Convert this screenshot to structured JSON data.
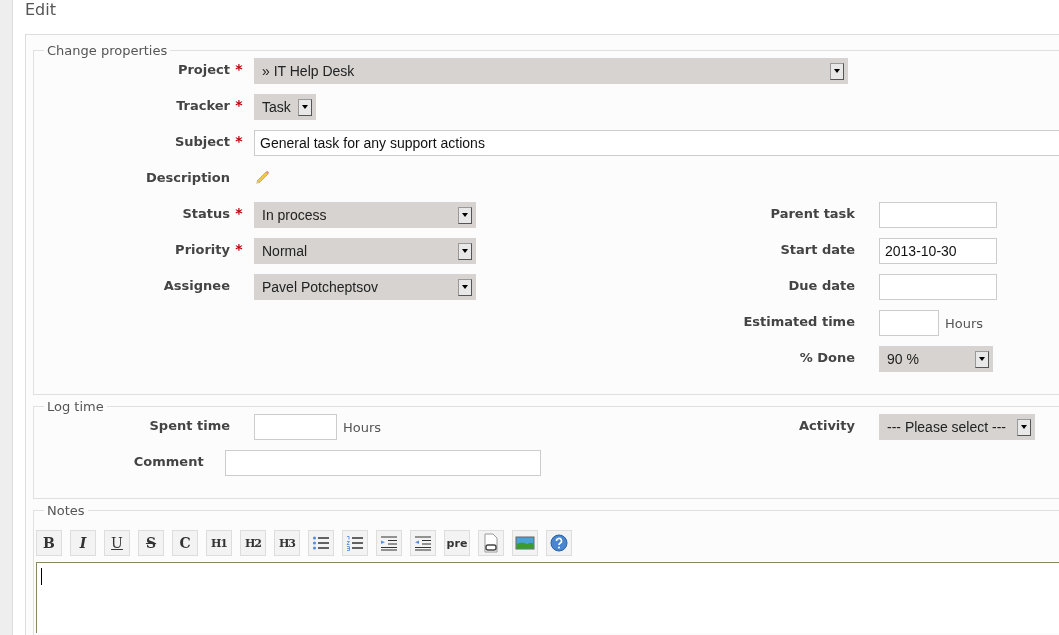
{
  "page_title": "Edit",
  "properties": {
    "legend": "Change properties",
    "top_fields": [
      {
        "kind": "select",
        "label": "Project",
        "required_mark": "*",
        "value": "» IT Help Desk"
      },
      {
        "kind": "select",
        "label": "Tracker",
        "required_mark": "*",
        "value": "Task"
      },
      {
        "kind": "text",
        "label": "Subject",
        "required_mark": "*",
        "value": "General task for any support actions"
      },
      {
        "kind": "pencil",
        "label": "Description"
      }
    ],
    "left_fields": [
      {
        "kind": "select",
        "label": "Status",
        "required_mark": "*",
        "value": "In process"
      },
      {
        "kind": "select",
        "label": "Priority",
        "required_mark": "*",
        "value": "Normal"
      },
      {
        "kind": "select",
        "label": "Assignee",
        "value": "Pavel Potcheptsov"
      }
    ],
    "right_fields": [
      {
        "kind": "text",
        "label": "Parent task"
      },
      {
        "kind": "text",
        "label": "Start date",
        "value": "2013-10-30"
      },
      {
        "kind": "text",
        "label": "Due date"
      },
      {
        "kind": "text",
        "label": "Estimated time",
        "unit": "Hours"
      },
      {
        "kind": "select",
        "label": "% Done",
        "value": "90 %"
      }
    ]
  },
  "log_time": {
    "legend": "Log time",
    "left_fields": [
      {
        "kind": "text",
        "label": "Spent time",
        "unit": "Hours"
      },
      {
        "kind": "text",
        "label": "Comment"
      }
    ],
    "right_fields": [
      {
        "kind": "select",
        "label": "Activity",
        "value": "--- Please select ---"
      }
    ]
  },
  "notes": {
    "legend": "Notes",
    "toolbar": [
      {
        "kind": "bold",
        "label": "B"
      },
      {
        "kind": "italic",
        "label": "I"
      },
      {
        "kind": "underline",
        "label": "U"
      },
      {
        "kind": "strike",
        "label": "S"
      },
      {
        "kind": "code",
        "label": "C"
      },
      {
        "kind": "heading",
        "label": "H1"
      },
      {
        "kind": "heading",
        "label": "H2"
      },
      {
        "kind": "heading",
        "label": "H3"
      },
      {
        "kind": "ul"
      },
      {
        "kind": "ol"
      },
      {
        "kind": "indent"
      },
      {
        "kind": "outdent"
      },
      {
        "kind": "pre",
        "label": "pre"
      },
      {
        "kind": "file"
      },
      {
        "kind": "image"
      },
      {
        "kind": "help"
      }
    ]
  }
}
